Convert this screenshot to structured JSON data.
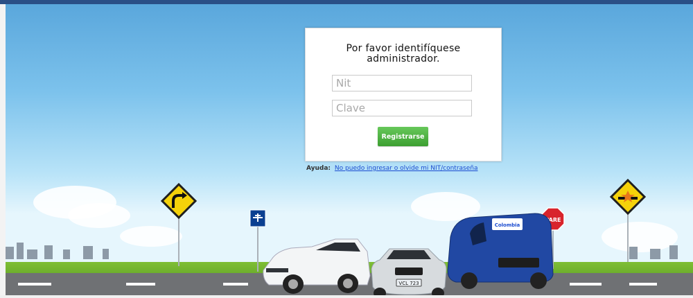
{
  "login": {
    "title": "Por favor identifíquese\nadministrador.",
    "fields": {
      "nit_placeholder": "Nit",
      "password_placeholder": "Clave"
    },
    "register_button": "Registrarse"
  },
  "help": {
    "label": "Ayuda:",
    "link_text": "No puedo ingresar o olvide mi NIT/contraseña"
  },
  "scene": {
    "sign_text": "PARE",
    "van_logo": "Colombia",
    "plate": "VCL 723"
  },
  "colors": {
    "frame": "#2a4f86",
    "button": "#4caf3f",
    "link": "#1b4cd0",
    "sky": "#6bb7e5"
  }
}
